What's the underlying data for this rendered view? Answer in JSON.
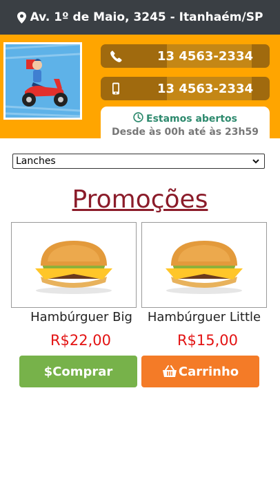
{
  "header": {
    "address": "Av. 1º de Maio, 3245 - Itanhaém/SP",
    "icon": "map-pin-icon"
  },
  "contacts": [
    {
      "icon": "phone-icon",
      "number": "13 4563-2334"
    },
    {
      "icon": "mobile-icon",
      "number": "13 4563-2334"
    }
  ],
  "hours": {
    "icon": "clock-icon",
    "status": "Estamos abertos",
    "range": "Desde às 00h até às 23h59"
  },
  "category_select": {
    "selected": "Lanches"
  },
  "section_title": "Promoções",
  "products": [
    {
      "name": "Hambúrguer Big",
      "price": "R$22,00"
    },
    {
      "name": "Hambúrguer Little",
      "price": "R$15,00"
    }
  ],
  "buttons": {
    "buy": "$Comprar",
    "cart": "Carrinho"
  },
  "colors": {
    "topbar": "#3a3f44",
    "header_bg": "#ffa500",
    "title": "#8b1c2a",
    "price": "#e31313",
    "buy_button": "#77b24a",
    "cart_button": "#f47b27",
    "open_status": "#2e8a6e"
  }
}
